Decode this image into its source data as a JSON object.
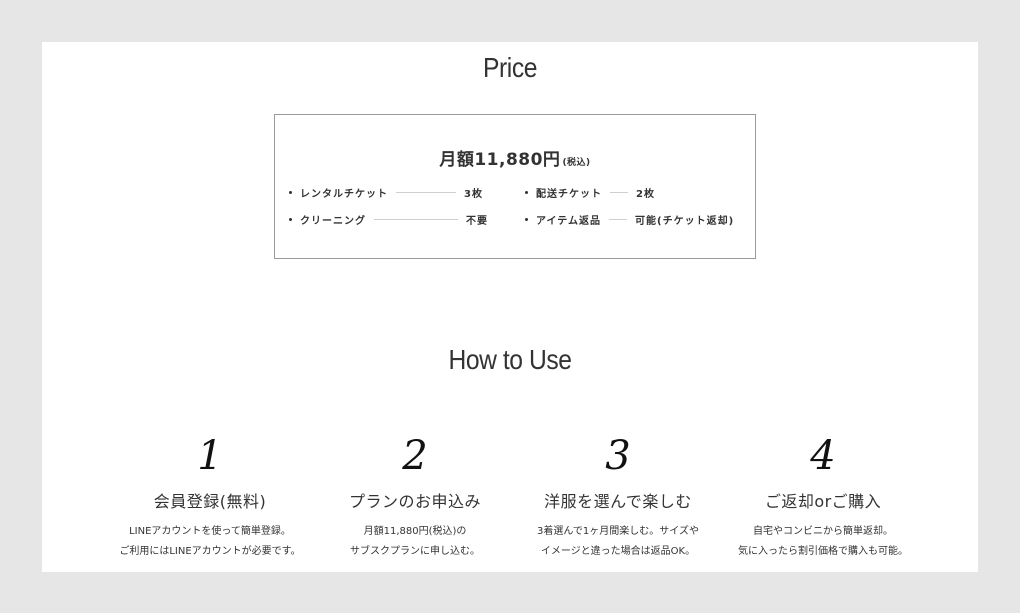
{
  "price": {
    "title": "Price",
    "amount": "月額11,880円",
    "tax_note": "(税込)",
    "features": [
      {
        "label": "レンタルチケット",
        "value": "3枚"
      },
      {
        "label": "配送チケット",
        "value": "2枚"
      },
      {
        "label": "クリーニング",
        "value": "不要"
      },
      {
        "label": "アイテム返品",
        "value": "可能(チケット返却)"
      }
    ]
  },
  "how_to_use": {
    "title": "How to Use",
    "steps": [
      {
        "number": "1",
        "title": "会員登録(無料)",
        "desc_line1": "LINEアカウントを使って簡単登録。",
        "desc_line2": "ご利用にはLINEアカウントが必要です。"
      },
      {
        "number": "2",
        "title": "プランのお申込み",
        "desc_line1": "月額11,880円(税込)の",
        "desc_line2": "サブスクプランに申し込む。"
      },
      {
        "number": "3",
        "title": "洋服を選んで楽しむ",
        "desc_line1": "3着選んで1ヶ月間楽しむ。サイズや",
        "desc_line2": "イメージと違った場合は返品OK。"
      },
      {
        "number": "4",
        "title": "ご返却orご購入",
        "desc_line1": "自宅やコンビニから簡単返却。",
        "desc_line2": "気に入ったら割引価格で購入も可能。"
      }
    ]
  }
}
